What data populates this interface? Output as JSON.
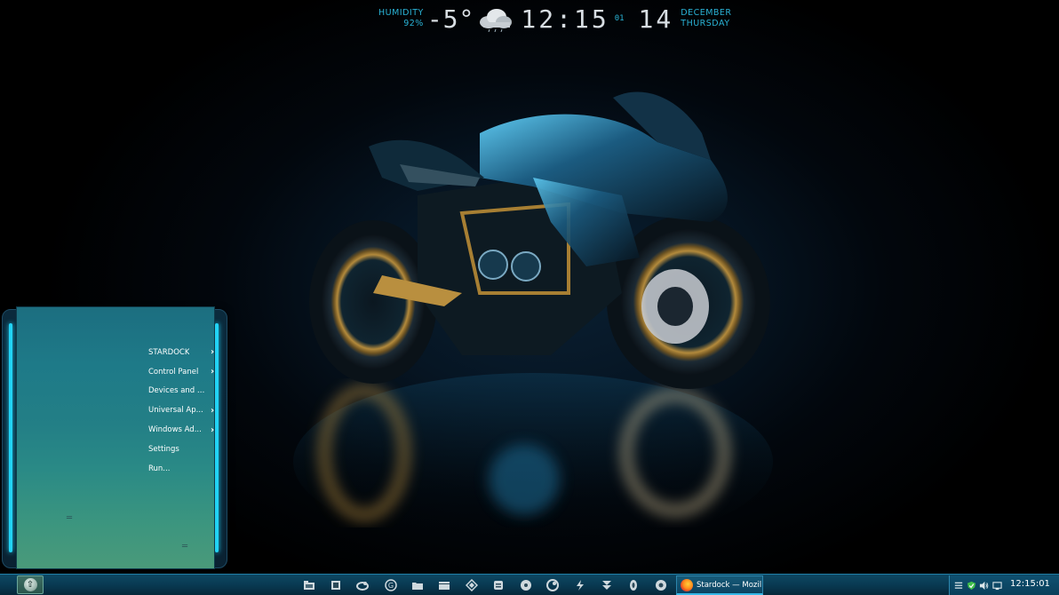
{
  "widget": {
    "humidity_label": "HUMIDITY",
    "humidity_value": "92%",
    "temperature": "-5°",
    "weather_icon": "cloud-icon",
    "time": "12:15",
    "seconds": "01",
    "day": "14",
    "month": "DECEMBER",
    "weekday": "THURSDAY"
  },
  "start_menu": {
    "items": [
      {
        "label": "STARDOCK",
        "has_submenu": true
      },
      {
        "label": "Control Panel",
        "has_submenu": true
      },
      {
        "label": "Devices and Prin...",
        "has_submenu": false
      },
      {
        "label": "Universal Ap...",
        "has_submenu": true
      },
      {
        "label": "Windows Ad...",
        "has_submenu": true
      },
      {
        "label": "Settings",
        "has_submenu": false
      },
      {
        "label": "Run...",
        "has_submenu": false
      }
    ],
    "chevron": "›",
    "grip_glyph": "═"
  },
  "taskbar": {
    "start_icon": "up-arrow-icon",
    "start_glyph": "⇧",
    "pinned_icons": [
      "file-manager-icon",
      "app-icon",
      "link-tool-icon",
      "g-app-icon",
      "folder-icon",
      "film-icon",
      "layers-icon",
      "disk-icon",
      "media-icon",
      "steam-icon",
      "bolt-icon",
      "download-icon",
      "b-app-icon",
      "chrome-icon"
    ],
    "active_task": {
      "icon": "firefox-icon",
      "label": "Stardock — Mozil..."
    },
    "tray": {
      "icons": [
        "menu-icon",
        "shield-check-icon",
        "volume-icon",
        "network-icon"
      ],
      "clock": "12:15:01"
    }
  },
  "colors": {
    "accent": "#2ab3d6",
    "glow": "#22d3f5",
    "taskbar": "#093a52",
    "menu_panel": "#1e7a88"
  }
}
